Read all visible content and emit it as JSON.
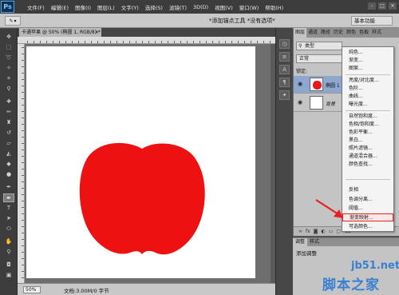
{
  "app": {
    "logo": "Ps",
    "menus": [
      "文件(F)",
      "编辑(E)",
      "图像(I)",
      "图层(L)",
      "文字(Y)",
      "选择(S)",
      "滤镜(T)",
      "3D(D)",
      "视图(V)",
      "窗口(W)",
      "帮助(H)"
    ],
    "window_buttons": [
      "–",
      "□",
      "✕"
    ]
  },
  "options_bar": {
    "hint": "*添加锚点工具 *没有选项*",
    "workspace": "基本功能"
  },
  "document": {
    "tab_label": "卡通苹果 @ 50% (椭圆 1, RGB/8) *",
    "tab_close": "×",
    "zoom": "50%",
    "doc_info": "文档:3.00M/0 字节"
  },
  "layers_panel": {
    "tabs": [
      "图层",
      "通道",
      "路径",
      "历史",
      "颜色",
      "色板",
      "样式"
    ],
    "filter_label": "类型",
    "blend_mode": "正常",
    "lock_label": "锁定:",
    "layers": [
      {
        "name": "椭圆 1",
        "selected": true
      },
      {
        "name": "背景",
        "selected": false
      }
    ],
    "footer_icons": [
      "link-icon",
      "fx-icon",
      "mask-icon",
      "adjustment-icon",
      "folder-icon",
      "new-layer-icon",
      "trash-icon"
    ],
    "footer_glyphs": [
      "∞",
      "fx",
      "◙",
      "◐",
      "▭",
      "▢",
      "⌫"
    ]
  },
  "adjustment_menu": {
    "groups": [
      [
        "纯色...",
        "渐变...",
        "图案..."
      ],
      [
        "亮度/对比度...",
        "色阶...",
        "曲线...",
        "曝光度..."
      ],
      [
        "自然饱和度...",
        "色相/饱和度...",
        "色彩平衡...",
        "黑白...",
        "照片滤镜...",
        "通道混合器...",
        "颜色查找..."
      ],
      [
        "反相",
        "色调分离...",
        "阈值...",
        "渐变映射...",
        "可选颜色..."
      ]
    ],
    "highlighted": "渐变映射..."
  },
  "adjust_panel": {
    "tabs": [
      "调整",
      "样式"
    ],
    "title": "添加调整"
  },
  "watermark": {
    "site": "jb51.net",
    "cn": "脚本之家"
  },
  "colors": {
    "apple_red": "#ee1111",
    "accent_highlight": "#e82020",
    "watermark_blue": "#3a7fd0"
  }
}
